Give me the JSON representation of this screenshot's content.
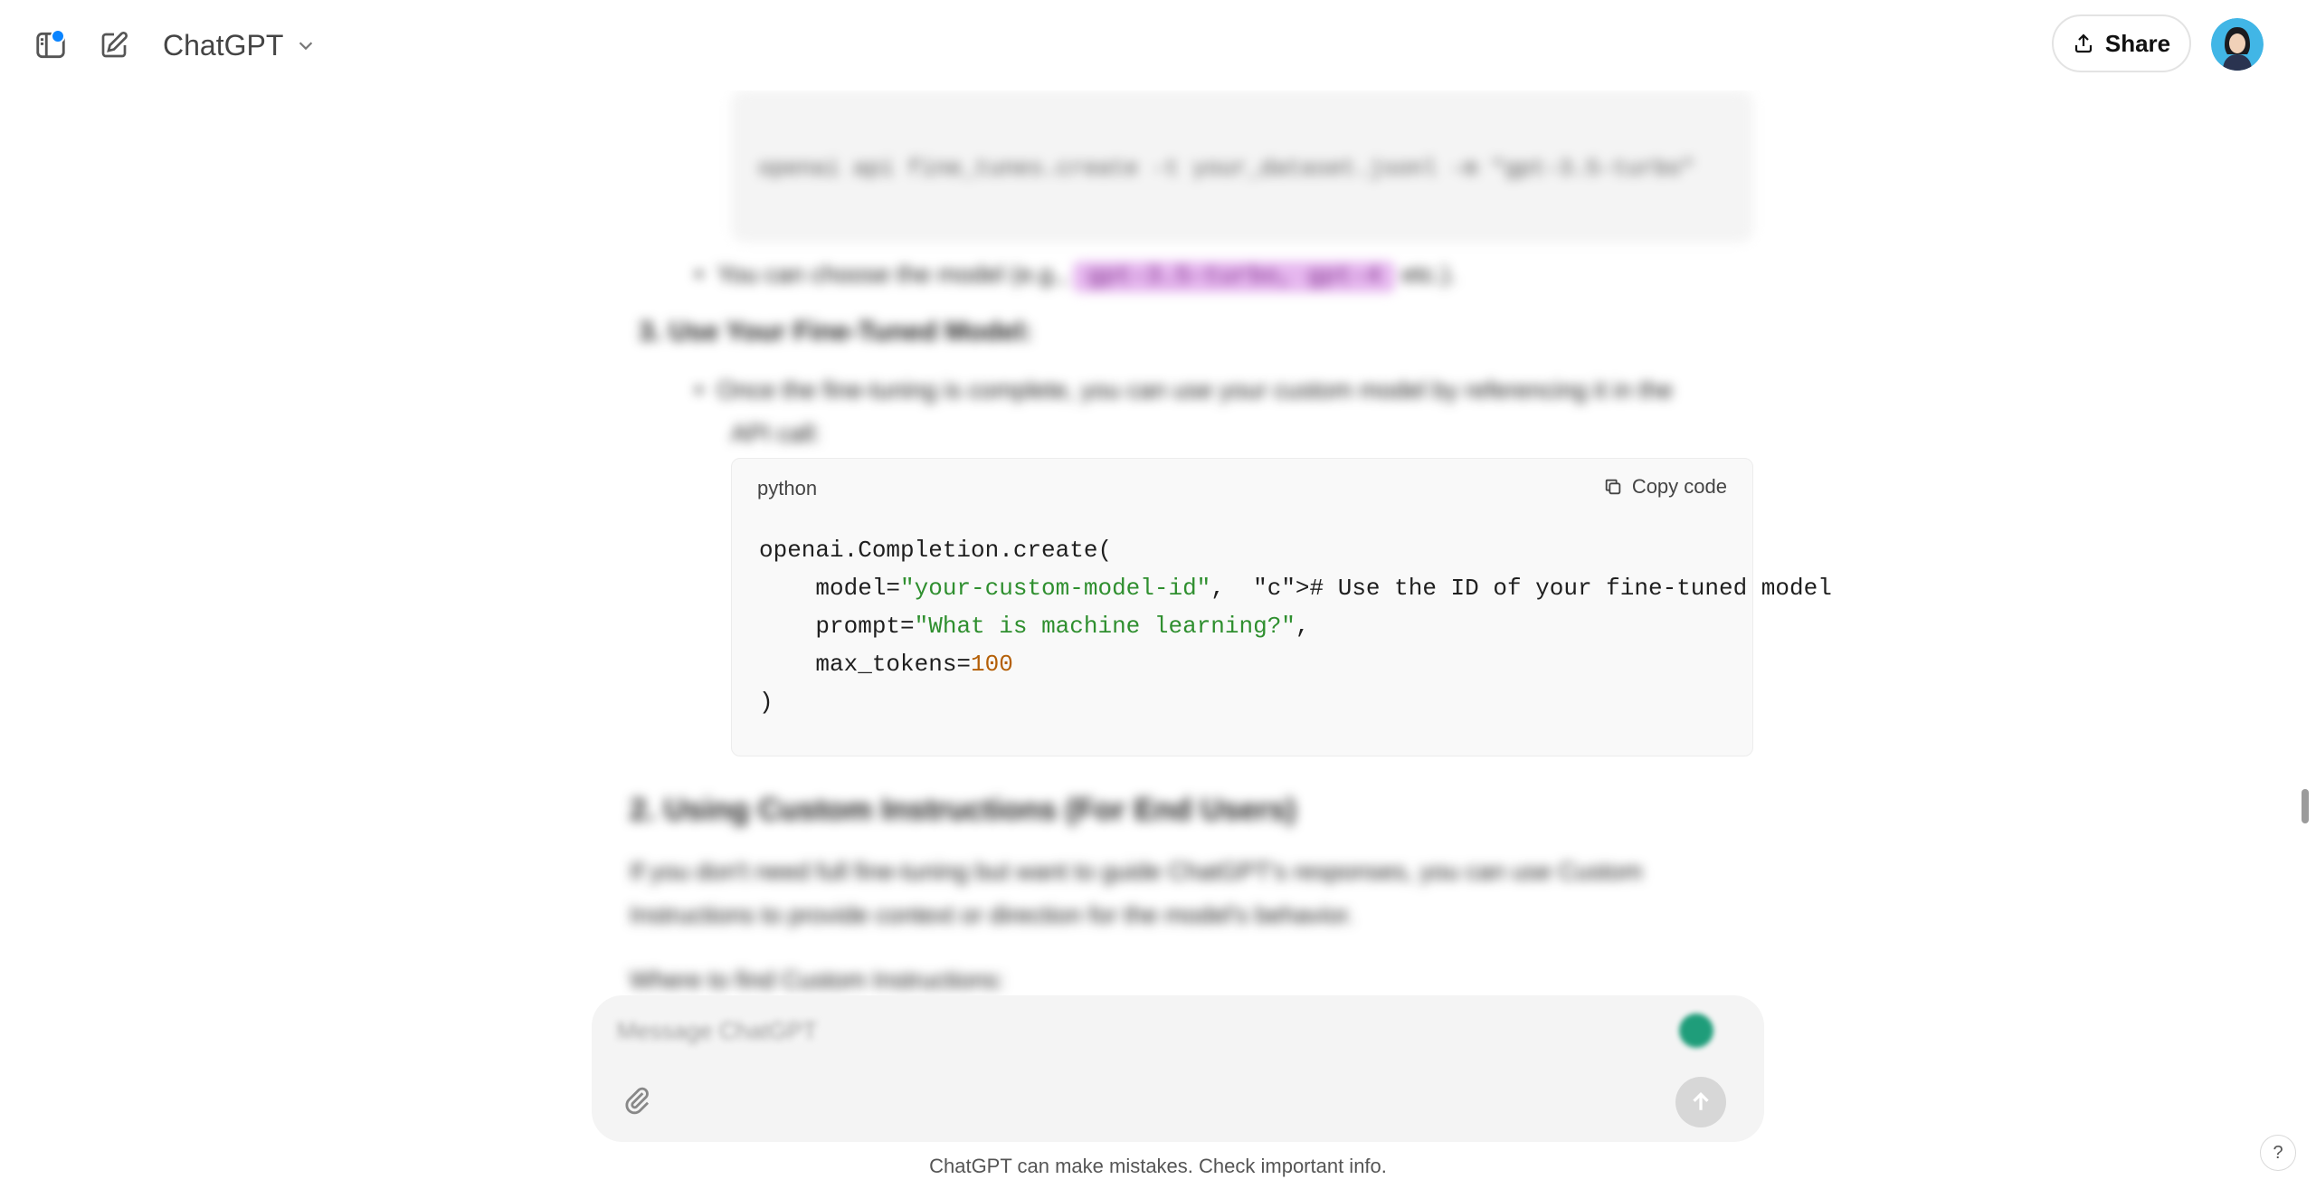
{
  "header": {
    "model_name": "ChatGPT",
    "share_label": "Share"
  },
  "code_block": {
    "language": "python",
    "copy_label": "Copy code",
    "lines": [
      "openai.Completion.create(",
      "    model=\"your-custom-model-id\",  # Use the ID of your fine-tuned model",
      "    prompt=\"What is machine learning?\",",
      "    max_tokens=100",
      ")"
    ]
  },
  "blurred": {
    "code_top_line": "openai api fine_tunes.create -t your_dataset.jsonl -m \"gpt-3.5-turbo\"",
    "bullet_model": "You can choose the model (e.g.,",
    "bullet_model_pill": "gpt-3.5-turbo, gpt-4",
    "bullet_model_tail": "etc.).",
    "step_heading": "3.  Use Your Fine-Tuned Model:",
    "step_text_1": "Once the fine-tuning is complete, you can use your custom model by referencing it in the",
    "step_text_2": "API call:",
    "section_heading": "2. Using Custom Instructions (For End Users)",
    "para_1": "If you don't need full fine-tuning but want to guide ChatGPT's responses, you can use Custom",
    "para_2": "Instructions to provide context or direction for the model's behavior.",
    "para_3": "Where to find Custom Instructions:"
  },
  "input": {
    "placeholder": "Message ChatGPT"
  },
  "disclaimer": "ChatGPT can make mistakes. Check important info.",
  "help_label": "?",
  "icons": [
    "sidebar-toggle-icon",
    "new-chat-icon",
    "chevron-down-icon",
    "share-upload-icon",
    "copy-icon",
    "paperclip-icon",
    "arrow-up-icon"
  ]
}
